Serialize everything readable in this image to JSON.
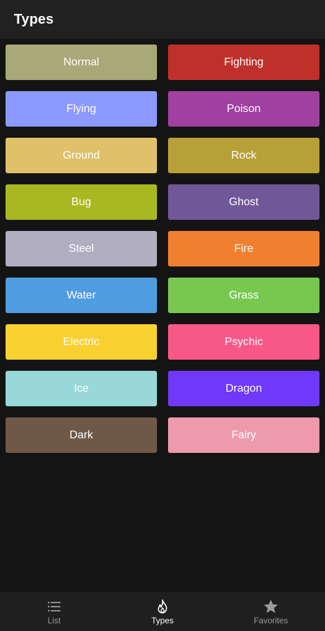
{
  "app_bar": {
    "title": "Types"
  },
  "types": [
    {
      "label": "Normal",
      "color": "#A8A878"
    },
    {
      "label": "Fighting",
      "color": "#C0302A"
    },
    {
      "label": "Flying",
      "color": "#8C99FE"
    },
    {
      "label": "Poison",
      "color": "#A040A0"
    },
    {
      "label": "Ground",
      "color": "#E0C068"
    },
    {
      "label": "Rock",
      "color": "#B8A038"
    },
    {
      "label": "Bug",
      "color": "#A8B820"
    },
    {
      "label": "Ghost",
      "color": "#705898"
    },
    {
      "label": "Steel",
      "color": "#B0AEC0"
    },
    {
      "label": "Fire",
      "color": "#F08030"
    },
    {
      "label": "Water",
      "color": "#509CE0"
    },
    {
      "label": "Grass",
      "color": "#78C850"
    },
    {
      "label": "Electric",
      "color": "#F8D030"
    },
    {
      "label": "Psychic",
      "color": "#F85888"
    },
    {
      "label": "Ice",
      "color": "#98D8D8"
    },
    {
      "label": "Dragon",
      "color": "#7038F8"
    },
    {
      "label": "Dark",
      "color": "#705848"
    },
    {
      "label": "Fairy",
      "color": "#EE99AC"
    }
  ],
  "bottom_nav": {
    "items": [
      {
        "label": "List",
        "icon": "list-icon",
        "active": false
      },
      {
        "label": "Types",
        "icon": "flame-icon",
        "active": true
      },
      {
        "label": "Favorites",
        "icon": "star-icon",
        "active": false
      }
    ]
  }
}
